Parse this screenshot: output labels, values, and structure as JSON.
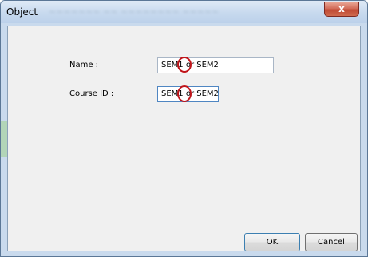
{
  "window": {
    "title": "Object",
    "close_glyph": "x"
  },
  "form": {
    "name": {
      "label": "Name :",
      "value": "SEM1 or SEM2"
    },
    "course_id": {
      "label": "Course ID :",
      "value": "SEM1 or SEM2"
    }
  },
  "buttons": {
    "ok": "OK",
    "cancel": "Cancel"
  },
  "colors": {
    "annotation_circle": "#c0141a",
    "close_button": "#c9503a"
  }
}
